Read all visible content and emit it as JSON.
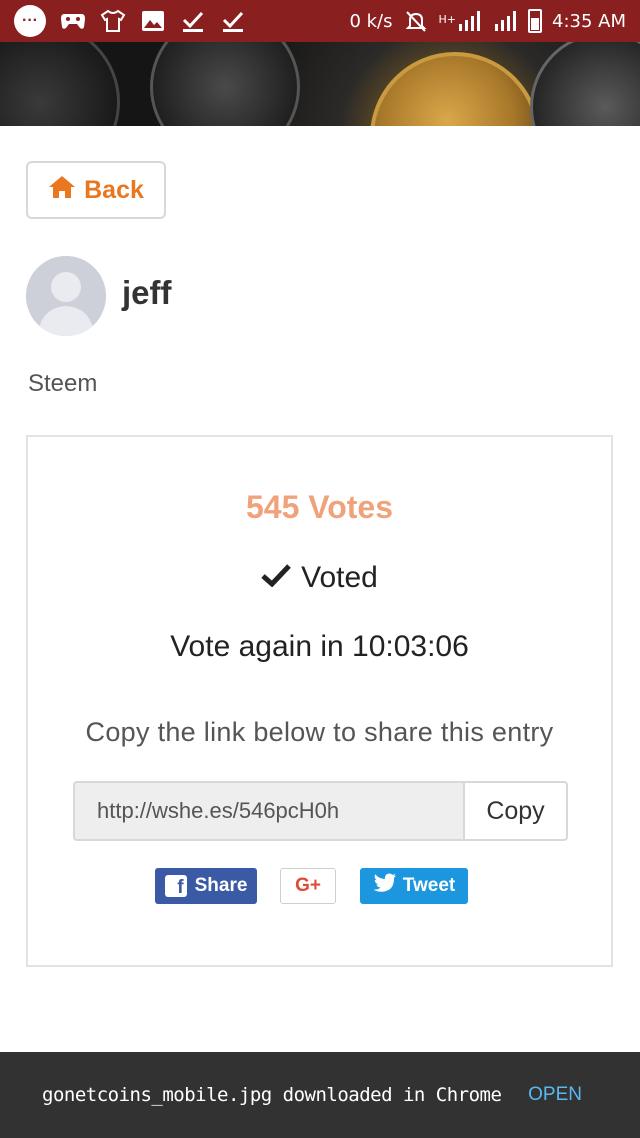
{
  "status_bar": {
    "net_speed": "0 k/s",
    "network_type": "H+",
    "time": "4:35 AM",
    "icons": [
      "message-bubble-icon",
      "controller-icon",
      "shirt-icon",
      "image-icon",
      "download-done-icon",
      "download-done-icon",
      "bell-off-icon",
      "signal-icon",
      "signal-icon",
      "battery-icon"
    ],
    "bubble_glyph": "···"
  },
  "header": {
    "banner": "crypto-coins-banner"
  },
  "back_button": {
    "label": "Back",
    "icon": "home-icon",
    "color": "#e8771f"
  },
  "profile": {
    "username": "jeff",
    "category": "Steem"
  },
  "vote_card": {
    "votes_label": "545 Votes",
    "votes_color": "#f0a27a",
    "voted_label": "Voted",
    "countdown_label": "Vote again in 10:03:06",
    "share_hint": "Copy the link below to share this entry",
    "share_link": "http://wshe.es/546pcH0h",
    "copy_label": "Copy"
  },
  "share_buttons": {
    "facebook": {
      "label": "Share",
      "color": "#3b5aa5"
    },
    "google_plus": {
      "label": "G+",
      "color": "#dd4b39"
    },
    "twitter": {
      "label": "Tweet",
      "color": "#1d96e0"
    }
  },
  "snackbar": {
    "message": "gonetcoins_mobile.jpg downloaded in Chrome",
    "action": "OPEN"
  }
}
